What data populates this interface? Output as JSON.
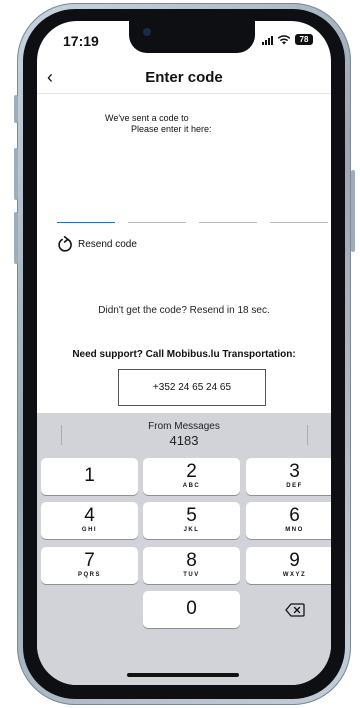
{
  "status": {
    "time": "17:19",
    "battery": "78"
  },
  "nav": {
    "back_icon": "chevron-left-icon",
    "title": "Enter code"
  },
  "content": {
    "sent_line1": "We've sent a code to",
    "sent_line2": "Please enter it here:",
    "code_digits": [
      "",
      "",
      "",
      ""
    ],
    "resend_label": "Resend code",
    "resend_icon": "refresh-icon",
    "timer_text": "Didn't get the code? Resend in 18 sec.",
    "support_text": "Need support? Call Mobibus.lu Transportation:",
    "phone_number": "+352 24 65 24 65"
  },
  "keyboard": {
    "suggestion_source": "From Messages",
    "suggestion_code": "4183",
    "keys": [
      {
        "digit": "1",
        "letters": ""
      },
      {
        "digit": "2",
        "letters": "ABC"
      },
      {
        "digit": "3",
        "letters": "DEF"
      },
      {
        "digit": "4",
        "letters": "GHI"
      },
      {
        "digit": "5",
        "letters": "JKL"
      },
      {
        "digit": "6",
        "letters": "MNO"
      },
      {
        "digit": "7",
        "letters": "PQRS"
      },
      {
        "digit": "8",
        "letters": "TUV"
      },
      {
        "digit": "9",
        "letters": "WXYZ"
      },
      {
        "digit": "0",
        "letters": ""
      }
    ],
    "backspace_icon": "backspace-icon"
  },
  "colors": {
    "accent": "#2f67c8",
    "keyboard_bg": "#d1d3d9"
  }
}
